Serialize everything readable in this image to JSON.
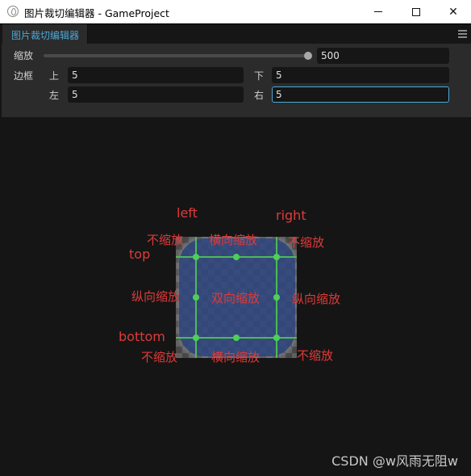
{
  "window": {
    "title": "图片裁切编辑器 - GameProject",
    "icon": "app-drop-icon",
    "controls": {
      "minimize": "minimize-icon",
      "maximize": "maximize-icon",
      "close": "✕"
    }
  },
  "tabs": [
    {
      "label": "图片裁切编辑器",
      "active": true
    }
  ],
  "panel_menu_icon": "hamburger-menu-icon",
  "settings": {
    "zoom": {
      "label": "缩放",
      "value": "500",
      "slider_fraction": 1.0
    },
    "border": {
      "label": "边框",
      "top": {
        "label": "上",
        "value": "5"
      },
      "bottom": {
        "label": "下",
        "value": "5"
      },
      "left": {
        "label": "左",
        "value": "5"
      },
      "right": {
        "label": "右",
        "value": "5",
        "focused": true
      }
    }
  },
  "preview": {
    "labels": {
      "left": "left",
      "right": "right",
      "top": "top",
      "bottom": "bottom",
      "top_left": "不缩放",
      "top_center": "横向缩放",
      "top_right": "不缩放",
      "middle_left": "纵向缩放",
      "center": "双向缩放",
      "middle_right": "纵向缩放",
      "bottom_left": "不缩放",
      "bottom_center": "横向缩放",
      "bottom_right": "不缩放"
    },
    "colors": {
      "guide": "#4cbb55",
      "annotation": "#e03a3a",
      "accent": "#4aa8d8"
    }
  },
  "watermark": "CSDN @w风雨无阻w"
}
